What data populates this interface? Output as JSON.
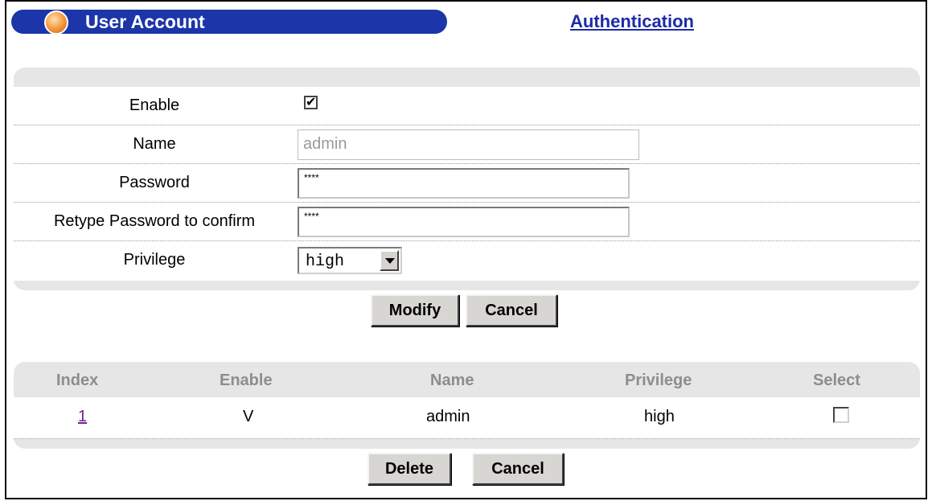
{
  "header": {
    "title": "User Account",
    "link": "Authentication"
  },
  "form": {
    "enable_label": "Enable",
    "enable_checked": true,
    "name_label": "Name",
    "name_value": "admin",
    "password_label": "Password",
    "password_value": "****",
    "retype_label": "Retype Password to confirm",
    "retype_value": "****",
    "privilege_label": "Privilege",
    "privilege_value": "high",
    "modify_label": "Modify",
    "cancel_label": "Cancel"
  },
  "table": {
    "columns": [
      "Index",
      "Enable",
      "Name",
      "Privilege",
      "Select"
    ],
    "rows": [
      {
        "index": "1",
        "enable": "V",
        "name": "admin",
        "privilege": "high",
        "selected": false
      }
    ],
    "delete_label": "Delete",
    "cancel_label": "Cancel"
  },
  "colors": {
    "title_bar": "#1c35a8",
    "link": "#1c2aa8",
    "panel": "#e6e6e6"
  }
}
